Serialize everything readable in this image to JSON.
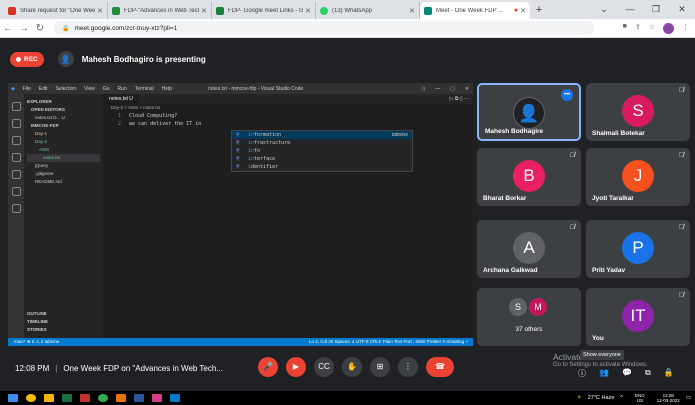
{
  "browser": {
    "tabs": [
      {
        "title": "Share request for \"One Wee",
        "color": "#d93025"
      },
      {
        "title": "FDP-\"Advances in Web Tech",
        "color": "#1e8e3e"
      },
      {
        "title": "FDP- Google meet Links - Go",
        "color": "#188038"
      },
      {
        "title": "(13) WhatsApp",
        "color": "#25d366"
      },
      {
        "title": "Meet - One Week FDP ...",
        "color": "#00897b"
      }
    ],
    "new_tab": "+",
    "url": "meet.google.com/zcr-tnuy-xtz?pli=1",
    "profile": "V"
  },
  "meet": {
    "rec_label": "REC",
    "presenter_text": "Mahesh Bodhagiro is presenting",
    "meeting_time": "12:08 PM",
    "meeting_title": "One Week FDP on \"Advances in Web Tech...",
    "activate_title": "Activate Windows",
    "activate_sub": "Go to Settings to activate Windows.",
    "tooltip": "Show everyone",
    "participants": [
      {
        "name": "Mahesh Bodhagire",
        "initial": "",
        "color": "#202124"
      },
      {
        "name": "Shalmali Botekar",
        "initial": "S",
        "color": "#d81b60"
      },
      {
        "name": "Bharat Borkar",
        "initial": "B",
        "color": "#e91e63"
      },
      {
        "name": "Jyoti Taralkar",
        "initial": "J",
        "color": "#f4511e"
      },
      {
        "name": "Archana Gaikwad",
        "initial": "A",
        "color": "#5f6368"
      },
      {
        "name": "Priti Yadav",
        "initial": "P",
        "color": "#1a73e8"
      },
      {
        "name": "37 others",
        "initials": [
          "S",
          "M"
        ],
        "colors": [
          "#5f6368",
          "#c2185b"
        ]
      },
      {
        "name": "You",
        "initial": "IT",
        "color": "#8e24aa"
      }
    ]
  },
  "vscode": {
    "menu": [
      "File",
      "Edit",
      "Selection",
      "View",
      "Go",
      "Run",
      "Terminal",
      "Help"
    ],
    "window_title": "notes.txt - mmcoe-fdp - Visual Studio Code",
    "explorer_title": "EXPLORER",
    "open_editors": "OPEN EDITORS",
    "open_file": "notes.txt D... U",
    "folder": "MMCOE-FDP",
    "tree": [
      "Day-1",
      "Day-2",
      "AWS",
      "notes.txt",
      "jQuery",
      ".gitignore",
      "README.md"
    ],
    "outline": "OUTLINE",
    "timeline": "TIMELINE",
    "stories": "STORIES",
    "tab": "notes.txt U",
    "breadcrumb": "Day-2 > AWS > notes.txt",
    "lines": [
      {
        "n": "1",
        "text": "Cloud Computing?"
      },
      {
        "n": "2",
        "text": "    we can deliver the IT in"
      }
    ],
    "suggestions": [
      {
        "hl": "in",
        "rest": "formation",
        "detail": "tabnine"
      },
      {
        "hl": "in",
        "rest": "frastructure",
        "detail": ""
      },
      {
        "hl": "in",
        "rest": "fo",
        "detail": ""
      },
      {
        "hl": "in",
        "rest": "terface",
        "detail": ""
      },
      {
        "hl": "i",
        "rest": "dentifier",
        "detail": ""
      }
    ],
    "status_left": "main*  ⊗ 0 ⚠ 0  tabnine",
    "status_right": "Ln 2, Col 30   Spaces: 4   UTF-8   CRLF   Plain Text   Port : 5500   Prettier   Formatting ✓"
  },
  "taskbar": {
    "weather": "27°C Haze",
    "lang": "ENG",
    "region": "US",
    "time": "12:08",
    "date": "12-03-2022"
  }
}
